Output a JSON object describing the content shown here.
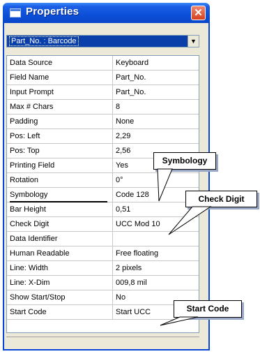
{
  "window": {
    "title": "Properties",
    "close_glyph": "✕"
  },
  "selector": {
    "value": "Part_No. : Barcode",
    "arrow_glyph": "▼"
  },
  "properties": [
    {
      "key": "Data Source",
      "value": "Keyboard"
    },
    {
      "key": "Field Name",
      "value": "Part_No."
    },
    {
      "key": "Input Prompt",
      "value": "Part_No."
    },
    {
      "key": "Max # Chars",
      "value": "8"
    },
    {
      "key": "Padding",
      "value": "None"
    },
    {
      "key": "Pos: Left",
      "value": "2,29"
    },
    {
      "key": "Pos: Top",
      "value": "2,56"
    },
    {
      "key": "Printing Field",
      "value": "Yes"
    },
    {
      "key": "Rotation",
      "value": "0°"
    },
    {
      "key": "Symbology",
      "value": "Code 128"
    },
    {
      "key": "Bar Height",
      "value": "0,51"
    },
    {
      "key": "Check Digit",
      "value": "UCC Mod 10"
    },
    {
      "key": "Data Identifier",
      "value": ""
    },
    {
      "key": "Human Readable",
      "value": "Free floating"
    },
    {
      "key": "Line:  Width",
      "value": " 2 pixels"
    },
    {
      "key": "Line: X-Dim",
      "value": "009,8 mil"
    },
    {
      "key": "Show Start/Stop",
      "value": "No"
    },
    {
      "key": "Start Code",
      "value": "Start UCC"
    }
  ],
  "callouts": {
    "symbology": "Symbology",
    "check_digit": "Check Digit",
    "start_code": "Start Code"
  },
  "colors": {
    "titlebar": "#0a46d8",
    "selection": "#0a3ea8",
    "close_button": "#d8401c"
  }
}
